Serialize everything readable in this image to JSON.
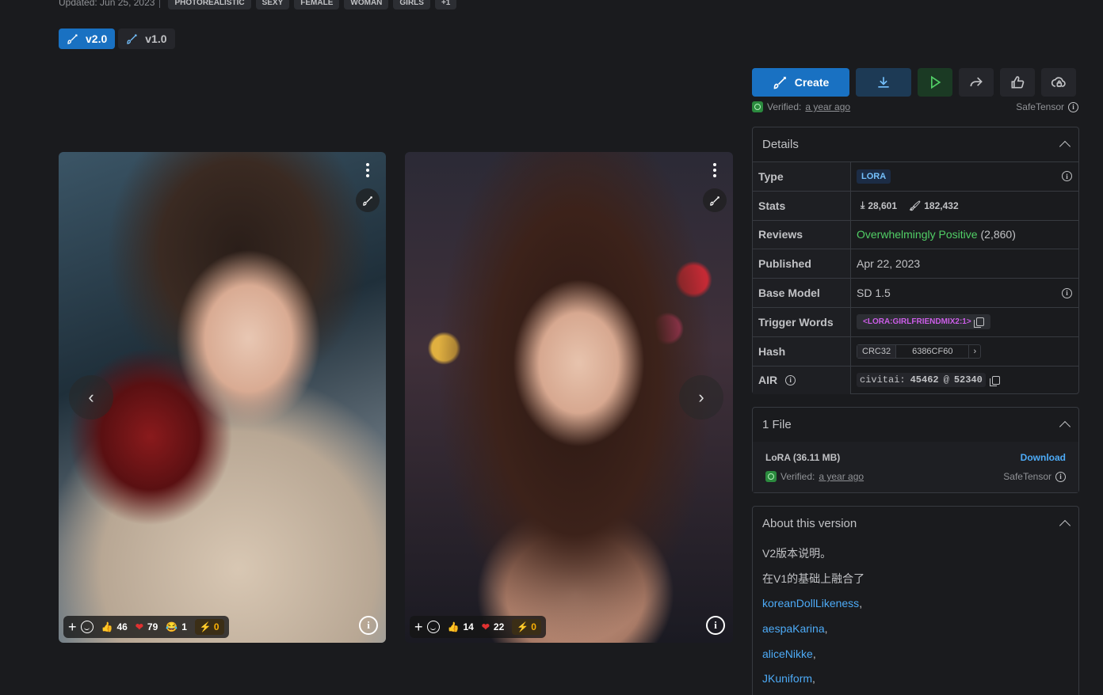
{
  "meta": {
    "updated": "Updated: Jun 25, 2023",
    "tags": [
      "PHOTOREALISTIC",
      "SEXY",
      "FEMALE",
      "WOMAN",
      "GIRLS",
      "+1"
    ]
  },
  "versions": [
    {
      "label": "v2.0",
      "active": true
    },
    {
      "label": "v1.0",
      "active": false
    }
  ],
  "gallery": {
    "images": [
      {
        "thumbs": "46",
        "hearts": "79",
        "laugh": "1",
        "buzz": "0"
      },
      {
        "thumbs": "14",
        "hearts": "22",
        "buzz": "0"
      }
    ],
    "prev_arrow": "‹",
    "next_arrow": "›"
  },
  "actions": {
    "create_label": "Create"
  },
  "verification": {
    "label": "Verified:",
    "when": "a year ago",
    "format": "SafeTensor"
  },
  "details": {
    "title": "Details",
    "rows": {
      "type": {
        "key": "Type",
        "value": "LORA"
      },
      "stats": {
        "key": "Stats",
        "downloads": "28,601",
        "generations": "182,432"
      },
      "reviews": {
        "key": "Reviews",
        "rating": "Overwhelmingly Positive",
        "count": "(2,860)"
      },
      "published": {
        "key": "Published",
        "value": "Apr 22, 2023"
      },
      "base_model": {
        "key": "Base Model",
        "value": "SD 1.5"
      },
      "trigger": {
        "key": "Trigger Words",
        "value": "<LORA:GIRLFRIENDMIX2:1>"
      },
      "hash": {
        "key": "Hash",
        "algo": "CRC32",
        "value": "6386CF60"
      },
      "air": {
        "key": "AIR",
        "prefix": "civitai:",
        "model": "45462",
        "at": "@",
        "version": "52340"
      }
    }
  },
  "files": {
    "title": "1 File",
    "name": "LoRA (36.11 MB)",
    "download": "Download",
    "verified_label": "Verified:",
    "verified_when": "a year ago",
    "format": "SafeTensor"
  },
  "about": {
    "title": "About this version",
    "lines": [
      "V2版本说明。",
      "在V1的基础上融合了"
    ],
    "links": [
      "koreanDollLikeness",
      "aespaKarina",
      "aliceNikke",
      "JKuniform"
    ]
  },
  "colors": {
    "accent": "#1971c2",
    "background": "#1a1b1e",
    "positive": "#51cf66",
    "link": "#4dabf7"
  }
}
